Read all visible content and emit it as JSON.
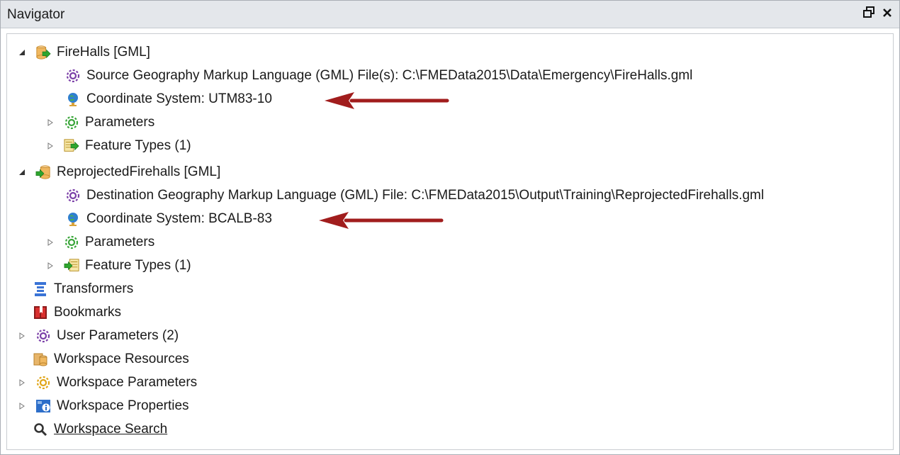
{
  "panel": {
    "title": "Navigator",
    "buttons": {
      "restore_icon": "restore-window-icon",
      "close_icon": "close-icon"
    }
  },
  "tree": {
    "reader": {
      "label": "FireHalls [GML]",
      "source": "Source Geography Markup Language (GML) File(s): C:\\FMEData2015\\Data\\Emergency\\FireHalls.gml",
      "coordinate": "Coordinate System: UTM83-10",
      "parameters": "Parameters",
      "feature_types": "Feature Types (1)"
    },
    "writer": {
      "label": "ReprojectedFirehalls [GML]",
      "destination": "Destination Geography Markup Language (GML) File: C:\\FMEData2015\\Output\\Training\\ReprojectedFirehalls.gml",
      "coordinate": "Coordinate System: BCALB-83",
      "parameters": "Parameters",
      "feature_types": "Feature Types (1)"
    },
    "transformers": "Transformers",
    "bookmarks": "Bookmarks",
    "user_parameters": "User Parameters (2)",
    "workspace_resources": "Workspace Resources",
    "workspace_parameters": "Workspace Parameters",
    "workspace_properties": "Workspace Properties",
    "workspace_search": "Workspace Search"
  },
  "colors": {
    "annotation_arrow": "#a11d1d",
    "link": "#1a33d6",
    "gear_purple": "#7b3fa8",
    "gear_green": "#3aa63a",
    "gear_orange": "#e0a516"
  }
}
